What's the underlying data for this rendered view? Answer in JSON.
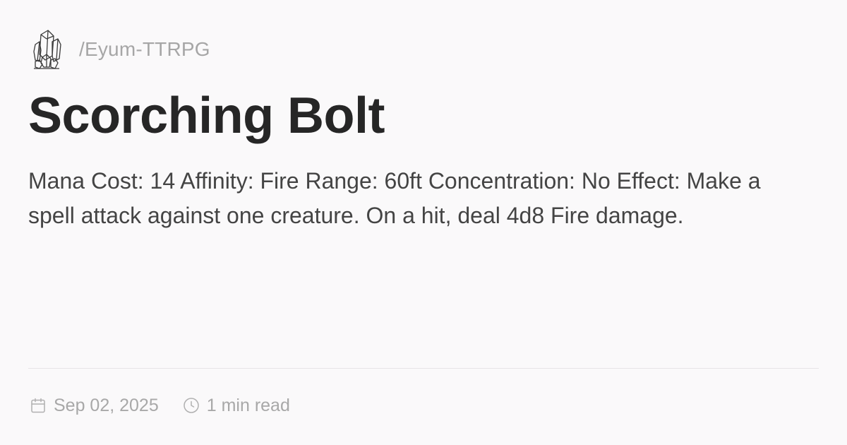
{
  "header": {
    "logo_icon": "crystal-cluster-icon",
    "breadcrumb": "/Eyum-TTRPG"
  },
  "article": {
    "title": "Scorching Bolt",
    "description": "Mana Cost: 14 Affinity: Fire Range: 60ft Concentration: No Effect: Make a spell attack against one creature. On a hit, deal 4d8 Fire damage."
  },
  "meta": {
    "date_icon": "calendar-icon",
    "date": "Sep 02, 2025",
    "read_time_icon": "clock-icon",
    "read_time": "1 min read"
  },
  "colors": {
    "background": "#faf9fa",
    "title": "#262626",
    "body_text": "#444444",
    "muted_text": "#a8a8a8",
    "divider": "#e6e4e6"
  }
}
